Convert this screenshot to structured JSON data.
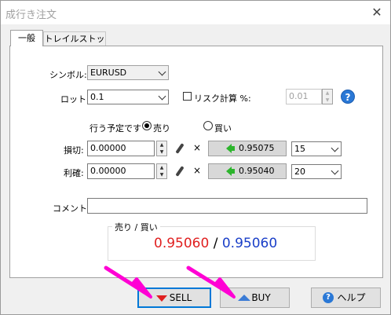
{
  "window": {
    "title": "成行き注文",
    "close_glyph": "✕"
  },
  "tabs": [
    {
      "label": "一般"
    },
    {
      "label": "トレイルストップ"
    }
  ],
  "symbol": {
    "label": "シンボル:",
    "value": "EURUSD"
  },
  "lot": {
    "label": "ロット:",
    "value": "0.1",
    "risk_label": "リスク計算 %:",
    "risk_value": "0.01",
    "help_glyph": "?"
  },
  "order": {
    "label": "行う予定です",
    "sell_label": "売り",
    "buy_label": "買い",
    "selected": "売り"
  },
  "stoploss": {
    "label": "損切:",
    "value": "0.00000",
    "x_glyph": "×",
    "price": "0.95075",
    "points": "15"
  },
  "takeprofit": {
    "label": "利確:",
    "value": "0.00000",
    "x_glyph": "×",
    "price": "0.95040",
    "points": "20"
  },
  "comment": {
    "label": "コメント:",
    "value": ""
  },
  "quote": {
    "title": "売り / 買い",
    "bid": "0.95060",
    "separator": "/",
    "ask": "0.95060",
    "bid_color": "#e02020",
    "ask_color": "#1a3fc8"
  },
  "buttons": {
    "sell": "SELL",
    "buy": "BUY",
    "help": "ヘルプ"
  },
  "colors": {
    "annotation_arrow": "#ff00d4",
    "focus_border": "#0078d7"
  }
}
